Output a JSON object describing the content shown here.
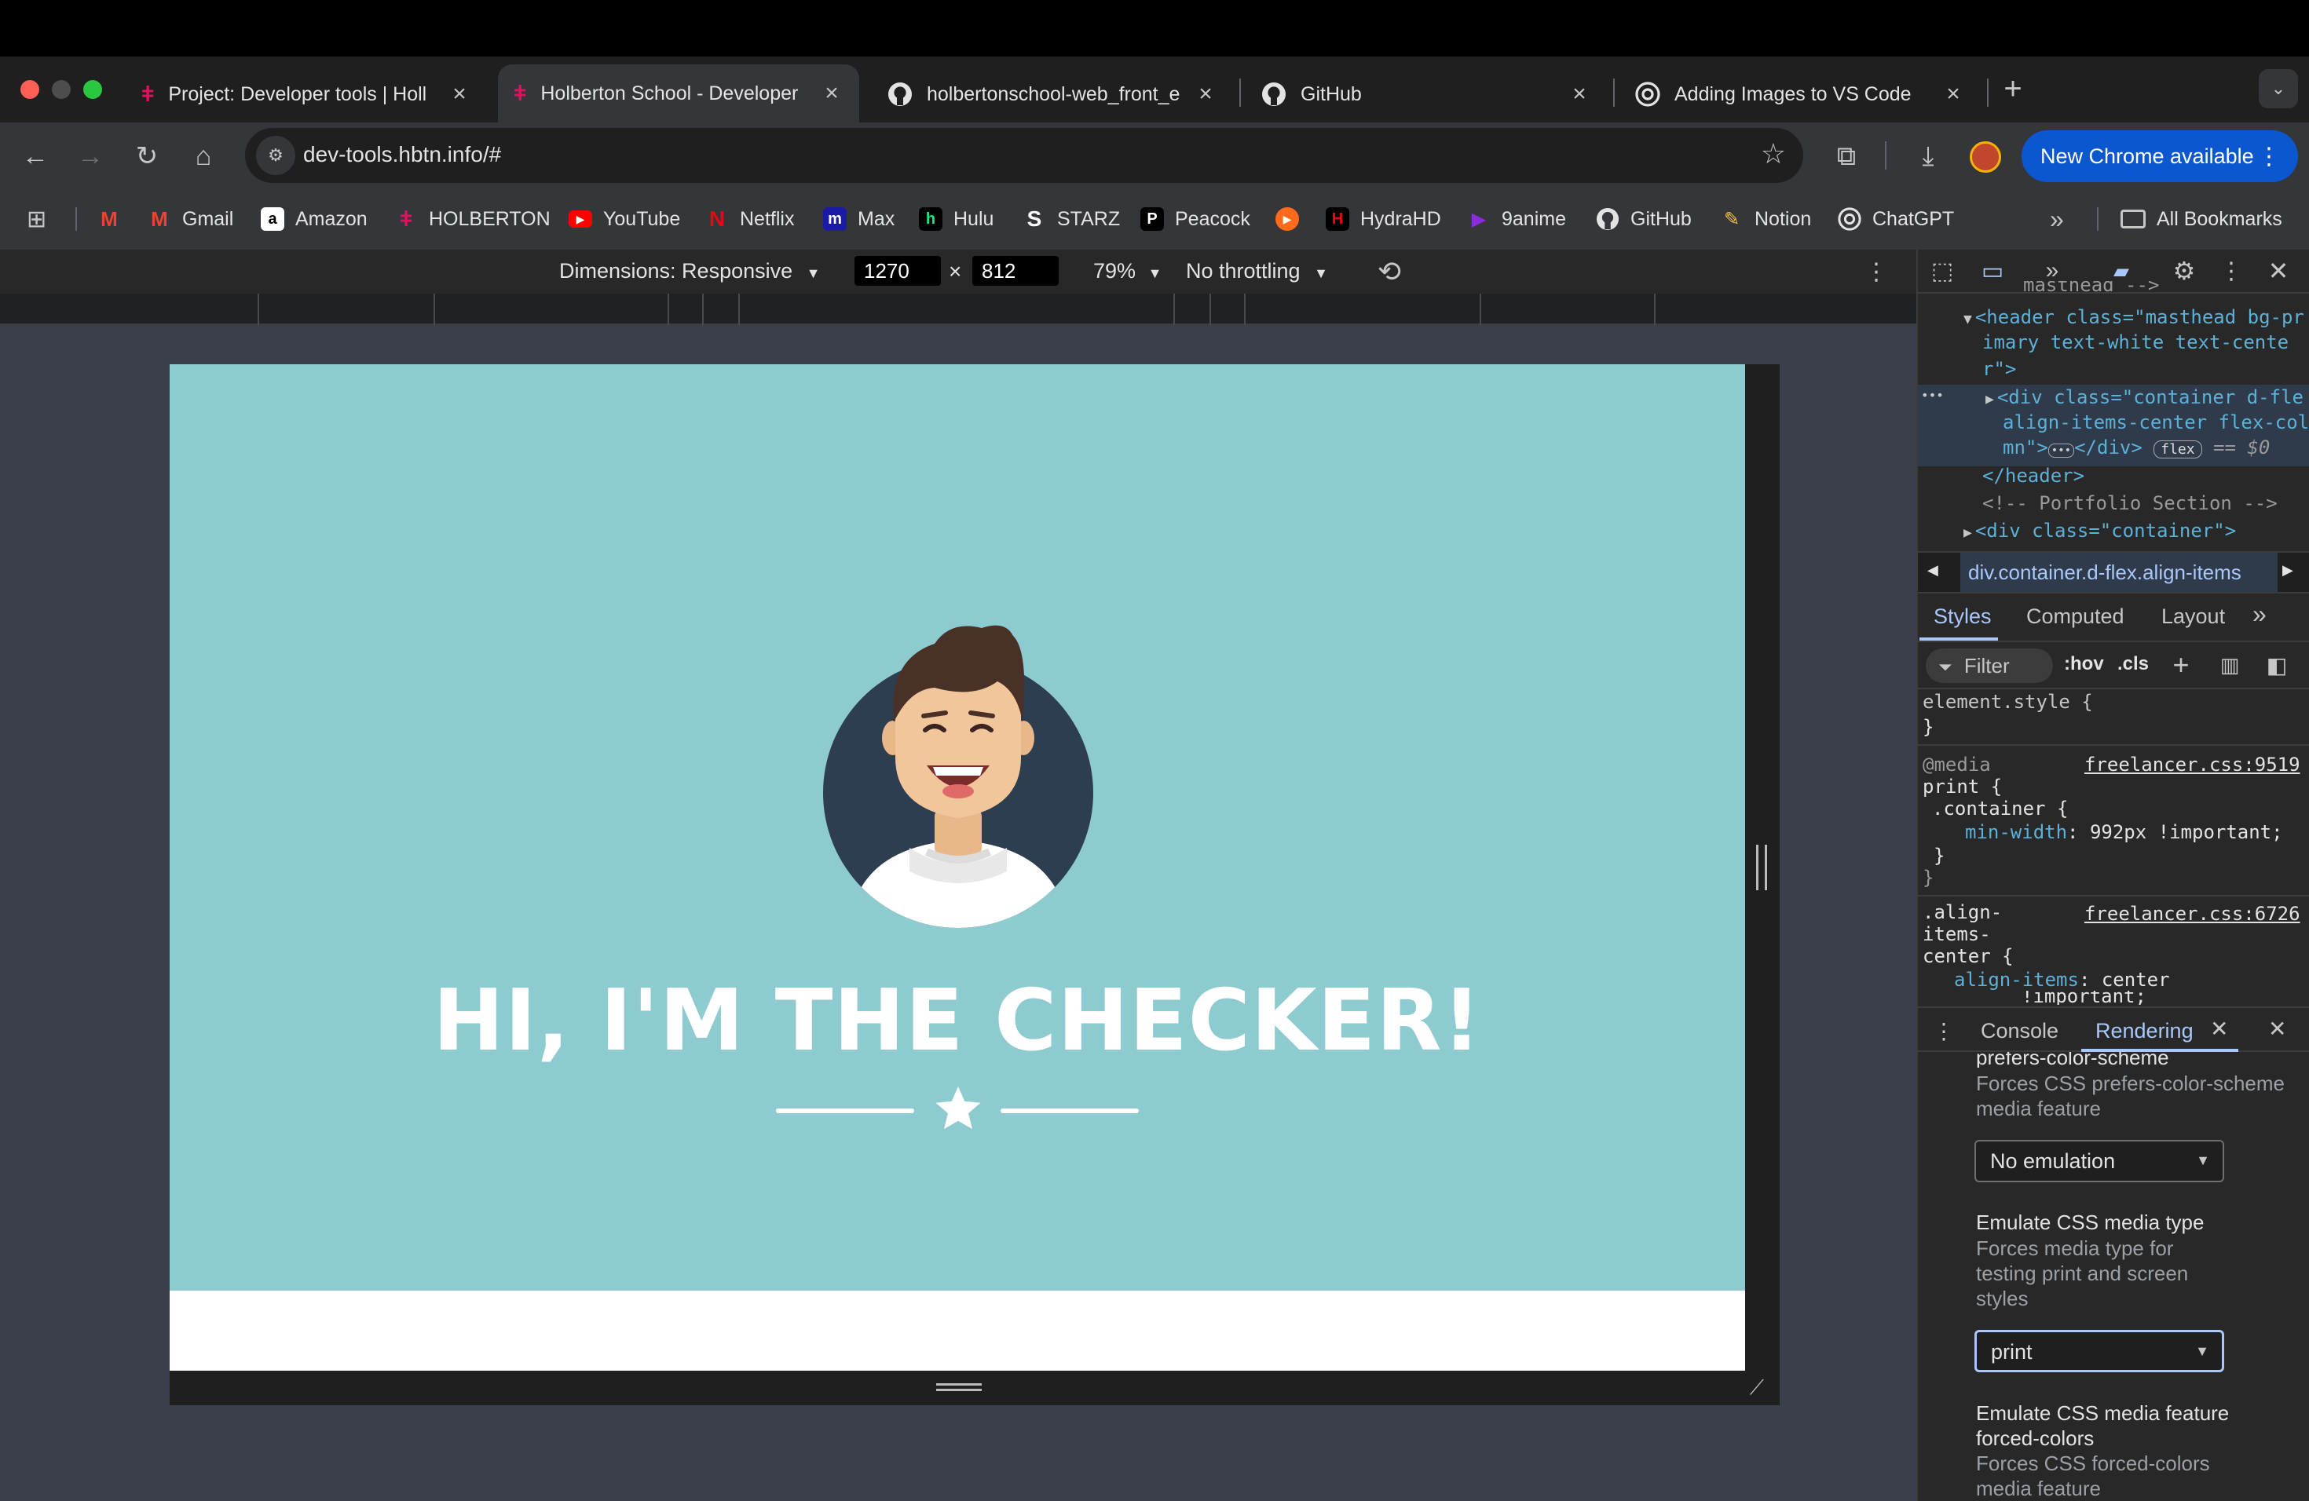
{
  "tabs": [
    {
      "title": "Project: Developer tools | Holl",
      "favicon": "holberton-icon",
      "active": false
    },
    {
      "title": "Holberton School - Developer",
      "favicon": "holberton-icon",
      "active": true
    },
    {
      "title": "holbertonschool-web_front_e",
      "favicon": "github-icon",
      "active": false
    },
    {
      "title": "GitHub",
      "favicon": "github-icon",
      "active": false
    },
    {
      "title": "Adding Images to VS Code",
      "favicon": "openai-icon",
      "active": false
    }
  ],
  "tab_close": "×",
  "new_tab": "+",
  "address": {
    "url": "dev-tools.hbtn.info/#"
  },
  "new_chrome_label": "New Chrome available",
  "bookmarks": [
    {
      "label": "",
      "icon": "gmail-icon"
    },
    {
      "label": "Gmail",
      "icon": "gmail-icon"
    },
    {
      "label": "Amazon",
      "icon": "amazon-icon"
    },
    {
      "label": "HOLBERTON",
      "icon": "holberton-icon"
    },
    {
      "label": "YouTube",
      "icon": "youtube-icon"
    },
    {
      "label": "Netflix",
      "icon": "netflix-icon"
    },
    {
      "label": "Max",
      "icon": "max-icon"
    },
    {
      "label": "Hulu",
      "icon": "hulu-icon"
    },
    {
      "label": "STARZ",
      "icon": "starz-icon"
    },
    {
      "label": "Peacock",
      "icon": "peacock-icon"
    },
    {
      "label": "",
      "icon": "play-icon"
    },
    {
      "label": "HydraHD",
      "icon": "hydrahd-icon"
    },
    {
      "label": "9anime",
      "icon": "9anime-icon"
    },
    {
      "label": "GitHub",
      "icon": "github-icon"
    },
    {
      "label": "Notion",
      "icon": "notion-icon"
    },
    {
      "label": "ChatGPT",
      "icon": "openai-icon"
    }
  ],
  "bookmarks_overflow": "»",
  "all_bookmarks": "All Bookmarks",
  "device_toolbar": {
    "dimensions_label": "Dimensions: Responsive",
    "width": "1270",
    "times": "×",
    "height": "812",
    "zoom": "79%",
    "throttling": "No throttling"
  },
  "page": {
    "heading": "HI, I'M THE CHECKER!",
    "background_color": "#8ecbd1"
  },
  "devtools": {
    "elements": {
      "line_cut": "masthead -->",
      "header_open_1": "<header class=\"masthead bg-pr",
      "header_open_2": "imary text-white text-cente",
      "header_open_3": "r\">",
      "div_1": "<div class=\"container d-fle",
      "div_2": "align-items-center flex-col",
      "div_3": "mn\">",
      "div_close": "</div>",
      "flex_badge": "flex",
      "eq": "== $0",
      "header_close": "</header>",
      "comment": "<!-- Portfolio Section -->",
      "div_container": "<div class=\"container\">",
      "row_ellipsis": "•••"
    },
    "breadcrumb": "div.container.d-flex.align-items",
    "styles_tabs": [
      "Styles",
      "Computed",
      "Layout"
    ],
    "filter_label": "Filter",
    "hov": ":hov",
    "cls": ".cls",
    "rules": {
      "element_style": "element.style {",
      "close_brace": "}",
      "media_at": "@media",
      "media_print": "print {",
      "container_sel": ".container {",
      "min_width_prop": "min-width",
      "min_width_val": ": 992px !important;",
      "media_link": "freelancer.css:9519",
      "align_sel_1": ".align-",
      "align_sel_2": "items-",
      "align_sel_3": "center {",
      "align_prop": "align-items",
      "align_val": ": center",
      "align_important": "!important;",
      "align_link": "freelancer.css:6726"
    },
    "drawer_tabs": [
      "Console",
      "Rendering"
    ],
    "rendering": {
      "cut_title": "prefers-color-scheme",
      "pcs_desc": "Forces CSS prefers-color-scheme media feature",
      "pcs_value": "No emulation",
      "media_type_title": "Emulate CSS media type",
      "media_type_desc": "Forces media type for testing print and screen styles",
      "media_type_value": "print",
      "forced_colors_title": "Emulate CSS media feature forced-colors",
      "forced_colors_desc": "Forces CSS forced-colors media feature"
    }
  }
}
